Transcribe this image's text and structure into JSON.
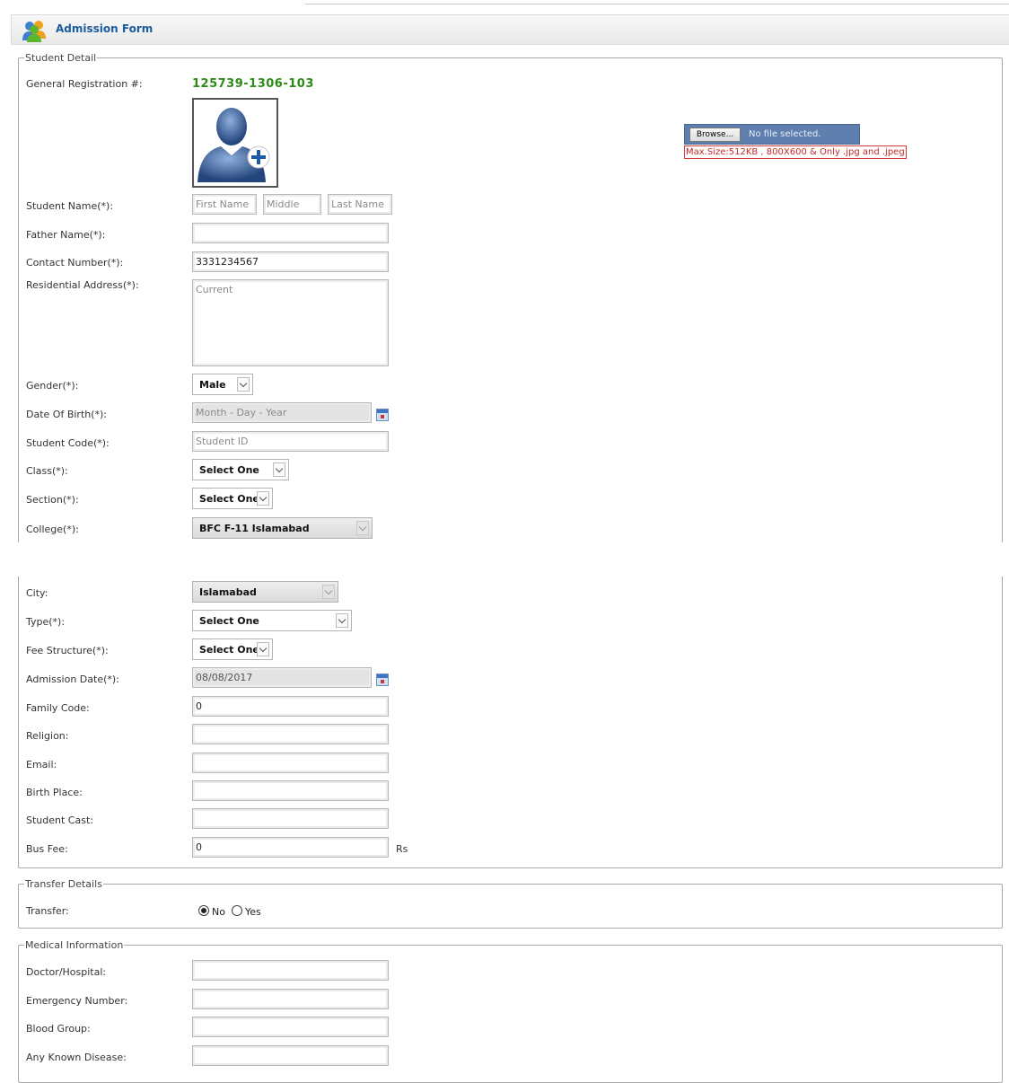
{
  "header": {
    "title": "Admission Form",
    "icon": "users-icon"
  },
  "student_detail": {
    "legend": "Student Detail",
    "registration": {
      "label": "General Registration #:",
      "value": "125739-1306-103"
    },
    "photo": {
      "icon": "add-photo-icon"
    },
    "upload": {
      "button_label": "Browse...",
      "status": "No file selected.",
      "note": "Max.Size:512KB , 800X600 & Only .jpg and .jpeg"
    },
    "student_name": {
      "label": "Student Name(*):",
      "first_placeholder": "First Name",
      "middle_placeholder": "Middle",
      "last_placeholder": "Last Name"
    },
    "father_name": {
      "label": "Father Name(*):",
      "value": ""
    },
    "contact_number": {
      "label": "Contact Number(*):",
      "value": "3331234567"
    },
    "address": {
      "label": "Residential Address(*):",
      "placeholder": "Current"
    },
    "gender": {
      "label": "Gender(*):",
      "value": "Male"
    },
    "dob": {
      "label": "Date Of Birth(*):",
      "placeholder": "Month - Day - Year"
    },
    "student_code": {
      "label": "Student Code(*):",
      "placeholder": "Student ID"
    },
    "class": {
      "label": "Class(*):",
      "value": "Select One"
    },
    "section": {
      "label": "Section(*):",
      "value": "Select One"
    },
    "college": {
      "label": "College(*):",
      "value": "BFC F-11 Islamabad"
    },
    "city": {
      "label": "City:",
      "value": "Islamabad"
    },
    "type": {
      "label": "Type(*):",
      "value": "Select One"
    },
    "fee_structure": {
      "label": "Fee Structure(*):",
      "value": "Select One"
    },
    "admission_date": {
      "label": "Admission Date(*):",
      "value": "08/08/2017"
    },
    "family_code": {
      "label": "Family Code:",
      "value": "0"
    },
    "religion": {
      "label": "Religion:",
      "value": ""
    },
    "email": {
      "label": "Email:",
      "value": ""
    },
    "birth_place": {
      "label": "Birth Place:",
      "value": ""
    },
    "student_cast": {
      "label": "Student Cast:",
      "value": ""
    },
    "bus_fee": {
      "label": "Bus Fee:",
      "value": "0",
      "unit": "Rs"
    }
  },
  "transfer": {
    "legend": "Transfer Details",
    "label": "Transfer:",
    "options": [
      "No",
      "Yes"
    ],
    "selected": "No"
  },
  "medical": {
    "legend": "Medical Information",
    "doctor": {
      "label": "Doctor/Hospital:",
      "value": ""
    },
    "emergency": {
      "label": "Emergency Number:",
      "value": ""
    },
    "blood_group": {
      "label": "Blood Group:",
      "value": ""
    },
    "disease": {
      "label": "Any Known Disease:",
      "value": ""
    }
  },
  "colors": {
    "accent": "#1a5c9e",
    "registration": "#2e8b17",
    "error_border": "#d23b3b"
  }
}
